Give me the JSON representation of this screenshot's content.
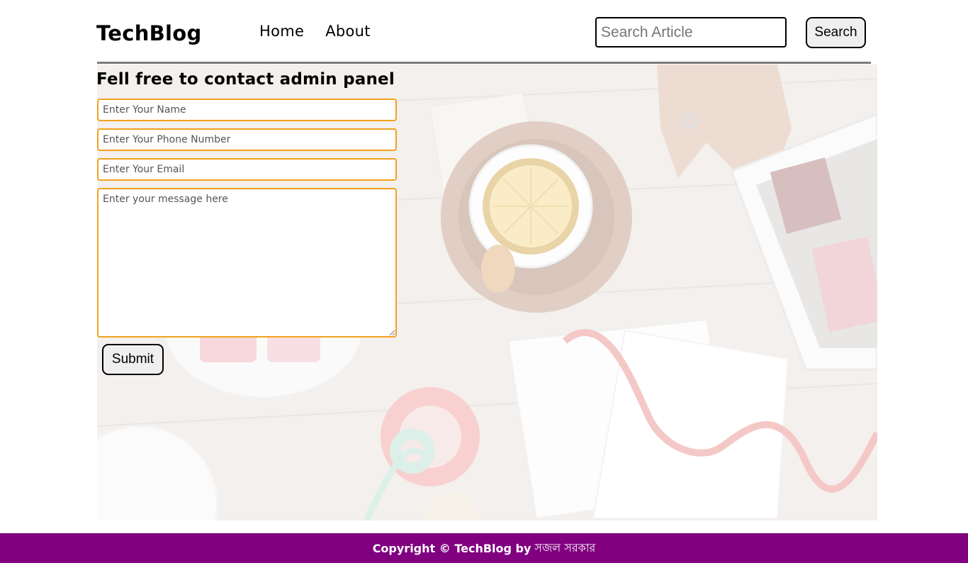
{
  "header": {
    "logo": "TechBlog",
    "nav": [
      "Home",
      "About"
    ],
    "search_placeholder": "Search Article",
    "search_button": "Search"
  },
  "contact": {
    "title": "Fell free to contact admin panel",
    "name_placeholder": "Enter Your Name",
    "phone_placeholder": "Enter Your Phone Number",
    "email_placeholder": "Enter Your Email",
    "message_placeholder": "Enter your message here",
    "submit_label": "Submit"
  },
  "footer": {
    "copyright": "Copyright © TechBlog by",
    "author": "সজল সরকার"
  },
  "colors": {
    "field_border": "#f2a21d",
    "footer_bg": "#800080",
    "divider": "#7a7a7a"
  }
}
